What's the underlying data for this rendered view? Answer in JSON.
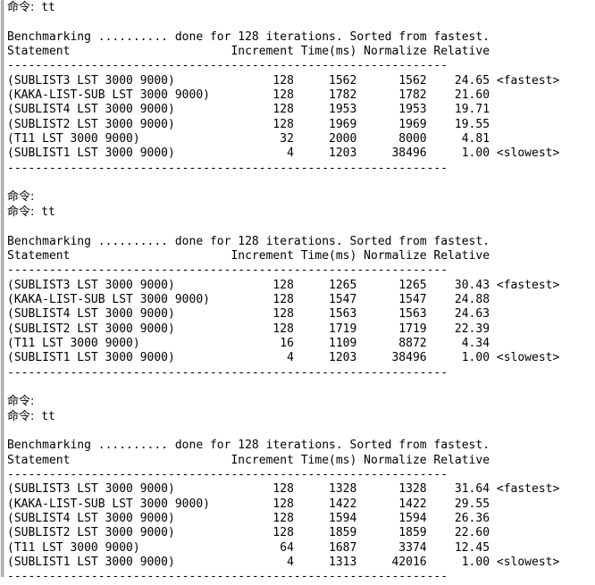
{
  "window": {
    "type": "console-terminal",
    "background_color": "#ffffff",
    "text_color": "#000000",
    "gutter_color": "#9a9a9a"
  },
  "prompt": {
    "label": "命令:",
    "command": "tt",
    "empty_prompt": "命令:"
  },
  "table": {
    "summary_prefix": "Benchmarking",
    "summary_dots": "..........",
    "summary_suffix": "done for 128 iterations. Sorted from fastest.",
    "iterations": 128,
    "columns": [
      "Statement",
      "Increment",
      "Time(ms)",
      "Normalize",
      "Relative"
    ],
    "separator": "---------------------------------------------------------------",
    "fastest_tag": "<fastest>",
    "slowest_tag": "<slowest>"
  },
  "blocks": [
    {
      "index": 1,
      "prompt_echo": "命令: tt",
      "show_empty_prompt": false,
      "header": "Benchmarking .......... done for 128 iterations. Sorted from fastest.",
      "rows": [
        {
          "statement": "(SUBLIST3 LST 3000 9000)",
          "increment": "128",
          "time_ms": "1562",
          "normalize": "1562",
          "relative": "24.65",
          "tag": "<fastest>"
        },
        {
          "statement": "(KAKA-LIST-SUB LST 3000 9000)",
          "increment": "128",
          "time_ms": "1782",
          "normalize": "1782",
          "relative": "21.60",
          "tag": ""
        },
        {
          "statement": "(SUBLIST4 LST 3000 9000)",
          "increment": "128",
          "time_ms": "1953",
          "normalize": "1953",
          "relative": "19.71",
          "tag": ""
        },
        {
          "statement": "(SUBLIST2 LST 3000 9000)",
          "increment": "128",
          "time_ms": "1969",
          "normalize": "1969",
          "relative": "19.55",
          "tag": ""
        },
        {
          "statement": "(T11 LST 3000 9000)",
          "increment": "32",
          "time_ms": "2000",
          "normalize": "8000",
          "relative": "4.81",
          "tag": ""
        },
        {
          "statement": "(SUBLIST1 LST 3000 9000)",
          "increment": "4",
          "time_ms": "1203",
          "normalize": "38496",
          "relative": "1.00",
          "tag": "<slowest>"
        }
      ]
    },
    {
      "index": 2,
      "prompt_echo": "命令: tt",
      "show_empty_prompt": true,
      "header": "Benchmarking .......... done for 128 iterations. Sorted from fastest.",
      "rows": [
        {
          "statement": "(SUBLIST3 LST 3000 9000)",
          "increment": "128",
          "time_ms": "1265",
          "normalize": "1265",
          "relative": "30.43",
          "tag": "<fastest>"
        },
        {
          "statement": "(KAKA-LIST-SUB LST 3000 9000)",
          "increment": "128",
          "time_ms": "1547",
          "normalize": "1547",
          "relative": "24.88",
          "tag": ""
        },
        {
          "statement": "(SUBLIST4 LST 3000 9000)",
          "increment": "128",
          "time_ms": "1563",
          "normalize": "1563",
          "relative": "24.63",
          "tag": ""
        },
        {
          "statement": "(SUBLIST2 LST 3000 9000)",
          "increment": "128",
          "time_ms": "1719",
          "normalize": "1719",
          "relative": "22.39",
          "tag": ""
        },
        {
          "statement": "(T11 LST 3000 9000)",
          "increment": "16",
          "time_ms": "1109",
          "normalize": "8872",
          "relative": "4.34",
          "tag": ""
        },
        {
          "statement": "(SUBLIST1 LST 3000 9000)",
          "increment": "4",
          "time_ms": "1203",
          "normalize": "38496",
          "relative": "1.00",
          "tag": "<slowest>"
        }
      ]
    },
    {
      "index": 3,
      "prompt_echo": "命令: tt",
      "show_empty_prompt": true,
      "header": "Benchmarking .......... done for 128 iterations. Sorted from fastest.",
      "rows": [
        {
          "statement": "(SUBLIST3 LST 3000 9000)",
          "increment": "128",
          "time_ms": "1328",
          "normalize": "1328",
          "relative": "31.64",
          "tag": "<fastest>"
        },
        {
          "statement": "(KAKA-LIST-SUB LST 3000 9000)",
          "increment": "128",
          "time_ms": "1422",
          "normalize": "1422",
          "relative": "29.55",
          "tag": ""
        },
        {
          "statement": "(SUBLIST4 LST 3000 9000)",
          "increment": "128",
          "time_ms": "1594",
          "normalize": "1594",
          "relative": "26.36",
          "tag": ""
        },
        {
          "statement": "(SUBLIST2 LST 3000 9000)",
          "increment": "128",
          "time_ms": "1859",
          "normalize": "1859",
          "relative": "22.60",
          "tag": ""
        },
        {
          "statement": "(T11 LST 3000 9000)",
          "increment": "64",
          "time_ms": "1687",
          "normalize": "3374",
          "relative": "12.45",
          "tag": ""
        },
        {
          "statement": "(SUBLIST1 LST 3000 9000)",
          "increment": "4",
          "time_ms": "1313",
          "normalize": "42016",
          "relative": "1.00",
          "tag": "<slowest>"
        }
      ]
    }
  ]
}
